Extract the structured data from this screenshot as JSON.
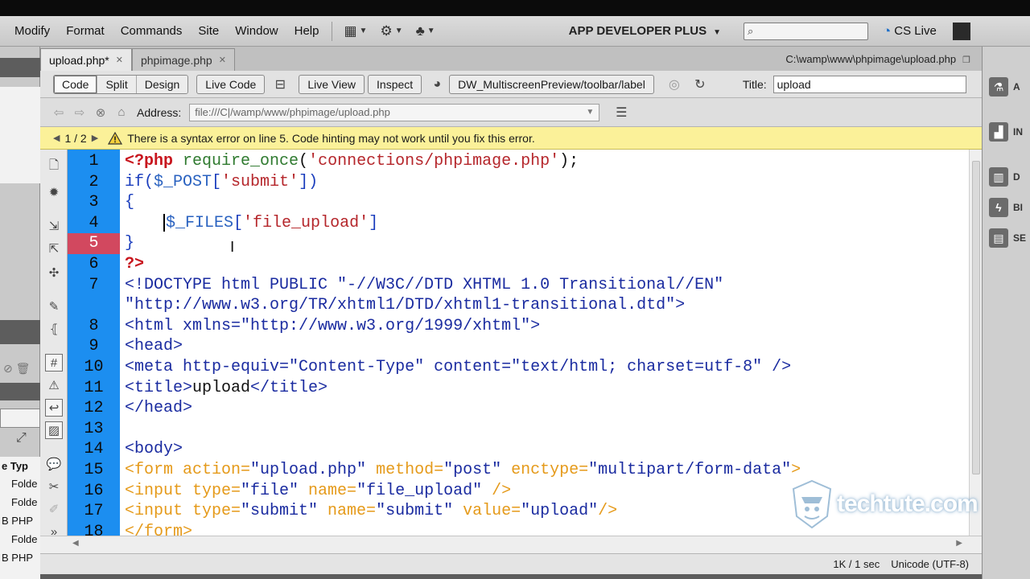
{
  "menu": [
    "Modify",
    "Format",
    "Commands",
    "Site",
    "Window",
    "Help"
  ],
  "workspace": "APP DEVELOPER PLUS",
  "cslive": "CS Live",
  "tabs": [
    {
      "label": "upload.php*"
    },
    {
      "label": "phpimage.php"
    }
  ],
  "doc_path": "C:\\wamp\\www\\phpimage\\upload.php",
  "toolbar": {
    "code": "Code",
    "split": "Split",
    "design": "Design",
    "live_code": "Live Code",
    "live_view": "Live View",
    "inspect": "Inspect",
    "multiscreen": "DW_MultiscreenPreview/toolbar/label",
    "title_label": "Title:",
    "title_value": "upload"
  },
  "address": {
    "label": "Address:",
    "value": "file:///C|/wamp/www/phpimage/upload.php"
  },
  "warning": {
    "count": "1 / 2",
    "message": "There is a syntax error on line 5.  Code hinting may not work until you fix this error."
  },
  "status": {
    "size": "1K / 1 sec",
    "encoding": "Unicode (UTF-8)"
  },
  "left_panel": {
    "col_header": "e Typ",
    "rows": [
      "Folde",
      "Folde",
      "B PHP",
      "Folde",
      "B PHP"
    ]
  },
  "right_panel": [
    "A",
    "IN",
    "D",
    "BI",
    "SE"
  ],
  "code_lines": [
    {
      "n": "1",
      "parts": [
        [
          "k-php",
          "<?php"
        ],
        [
          "k-fn",
          " require_once"
        ],
        [
          "k-txt",
          "("
        ],
        [
          "k-str",
          "'connections/phpimage.php'"
        ],
        [
          "k-txt",
          ");"
        ]
      ]
    },
    {
      "n": "2",
      "parts": [
        [
          "k-kw",
          "if("
        ],
        [
          "k-var",
          "$_POST"
        ],
        [
          "k-kw",
          "["
        ],
        [
          "k-str",
          "'submit'"
        ],
        [
          "k-kw",
          "])"
        ]
      ]
    },
    {
      "n": "3",
      "parts": [
        [
          "k-kw",
          "{"
        ]
      ]
    },
    {
      "n": "4",
      "caret": true,
      "parts": [
        [
          "k-txt",
          "    "
        ],
        [
          "k-var",
          "$_FILES"
        ],
        [
          "k-kw",
          "["
        ],
        [
          "k-str",
          "'file_upload'"
        ],
        [
          "k-kw",
          "]"
        ]
      ]
    },
    {
      "n": "5",
      "error": true,
      "parts": [
        [
          "k-kw",
          "}"
        ]
      ]
    },
    {
      "n": "6",
      "parts": [
        [
          "k-php",
          "?>"
        ]
      ]
    },
    {
      "n": "7",
      "parts": [
        [
          "k-tag",
          "<!DOCTYPE html PUBLIC \"-//W3C//DTD XHTML 1.0 Transitional//EN\""
        ]
      ]
    },
    {
      "n": "",
      "parts": [
        [
          "k-tag",
          "\"http://www.w3.org/TR/xhtml1/DTD/xhtml1-transitional.dtd\">"
        ]
      ]
    },
    {
      "n": "8",
      "parts": [
        [
          "k-tag",
          "<html xmlns="
        ],
        [
          "k-tagv",
          "\"http://www.w3.org/1999/xhtml\""
        ],
        [
          "k-tag",
          ">"
        ]
      ]
    },
    {
      "n": "9",
      "parts": [
        [
          "k-tag",
          "<head>"
        ]
      ]
    },
    {
      "n": "10",
      "parts": [
        [
          "k-tag",
          "<meta http-equiv="
        ],
        [
          "k-tagv",
          "\"Content-Type\""
        ],
        [
          "k-tag",
          " content="
        ],
        [
          "k-tagv",
          "\"text/html; charset=utf-8\""
        ],
        [
          "k-tag",
          " />"
        ]
      ]
    },
    {
      "n": "11",
      "parts": [
        [
          "k-tag",
          "<title>"
        ],
        [
          "k-txt",
          "upload"
        ],
        [
          "k-tag",
          "</title>"
        ]
      ]
    },
    {
      "n": "12",
      "parts": [
        [
          "k-tag",
          "</head>"
        ]
      ]
    },
    {
      "n": "13",
      "parts": []
    },
    {
      "n": "14",
      "parts": [
        [
          "k-tag",
          "<body>"
        ]
      ]
    },
    {
      "n": "15",
      "parts": [
        [
          "k-form",
          "<form action="
        ],
        [
          "k-tagv",
          "\"upload.php\""
        ],
        [
          "k-form",
          " method="
        ],
        [
          "k-tagv",
          "\"post\""
        ],
        [
          "k-form",
          " enctype="
        ],
        [
          "k-tagv",
          "\"multipart/form-data\""
        ],
        [
          "k-form",
          ">"
        ]
      ]
    },
    {
      "n": "16",
      "parts": [
        [
          "k-form",
          "<input type="
        ],
        [
          "k-tagv",
          "\"file\""
        ],
        [
          "k-form",
          " name="
        ],
        [
          "k-tagv",
          "\"file_upload\""
        ],
        [
          "k-form",
          " />"
        ]
      ]
    },
    {
      "n": "17",
      "parts": [
        [
          "k-form",
          "<input type="
        ],
        [
          "k-tagv",
          "\"submit\""
        ],
        [
          "k-form",
          " name="
        ],
        [
          "k-tagv",
          "\"submit\""
        ],
        [
          "k-form",
          " value="
        ],
        [
          "k-tagv",
          "\"upload\""
        ],
        [
          "k-form",
          "/>"
        ]
      ]
    },
    {
      "n": "18",
      "parts": [
        [
          "k-form",
          "</form>"
        ]
      ]
    }
  ],
  "watermark": "techtute.com",
  "colors": {
    "gutter": "#1c8ef0",
    "error_line": "#d2485f",
    "warning_bg": "#fbf199"
  }
}
